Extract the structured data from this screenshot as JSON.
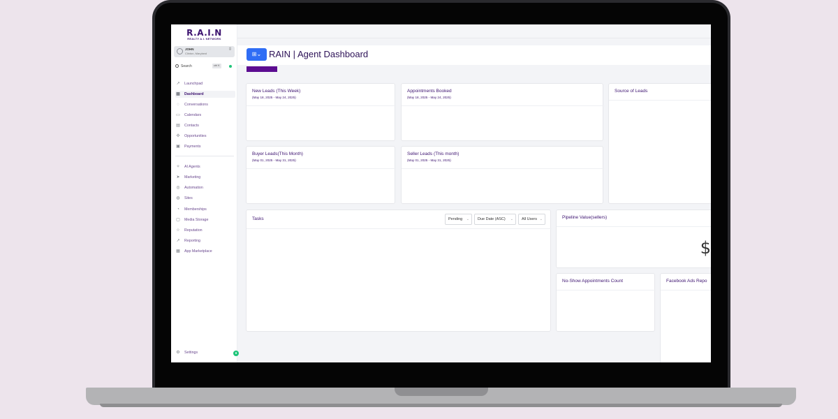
{
  "app": {
    "logo_main": "R.A.I.N",
    "logo_sub": "REALTY A.I. NETWORK",
    "page_title": "RAIN | Agent Dashboard"
  },
  "account": {
    "name": "JOHN",
    "location": "Clinton, Maryland"
  },
  "search": {
    "label": "Search",
    "shortcut": "ctrl K"
  },
  "sidebar": {
    "items": [
      {
        "label": "Launchpad",
        "icon": "rocket-icon"
      },
      {
        "label": "Dashboard",
        "icon": "grid-icon"
      },
      {
        "label": "Conversations",
        "icon": "chat-icon"
      },
      {
        "label": "Calendars",
        "icon": "calendar-icon"
      },
      {
        "label": "Contacts",
        "icon": "contacts-icon"
      },
      {
        "label": "Opportunities",
        "icon": "opportunities-icon"
      },
      {
        "label": "Payments",
        "icon": "payments-icon"
      },
      {
        "label": "AI Agents",
        "icon": "ai-icon"
      },
      {
        "label": "Marketing",
        "icon": "send-icon"
      },
      {
        "label": "Automation",
        "icon": "automation-icon"
      },
      {
        "label": "Sites",
        "icon": "globe-icon"
      },
      {
        "label": "Memberships",
        "icon": "membership-icon"
      },
      {
        "label": "Media Storage",
        "icon": "folder-icon"
      },
      {
        "label": "Reputation",
        "icon": "star-icon"
      },
      {
        "label": "Reporting",
        "icon": "chart-icon"
      },
      {
        "label": "App Marketplace",
        "icon": "apps-icon"
      }
    ],
    "settings_label": "Settings"
  },
  "cards": {
    "new_leads": {
      "title": "New Leads (This Week)",
      "range": "(May 18, 2025 - May 24, 2025)"
    },
    "appointments": {
      "title": "Appointments Booked",
      "range": "(May 18, 2025 - May 24, 2025)"
    },
    "source": {
      "title": "Source of Leads"
    },
    "buyer_leads": {
      "title": "Buyer Leads(This Month)",
      "range": "(May 01, 2025 - May 31, 2025)"
    },
    "seller_leads": {
      "title": "Seller Leads (This month)",
      "range": "(May 01, 2025 - May 31, 2025)"
    },
    "tasks": {
      "title": "Tasks",
      "filters": [
        "Pending",
        "Due Date (ASC)",
        "All Users"
      ]
    },
    "pipeline": {
      "title": "Pipeline Value(sellers)",
      "value": "$"
    },
    "no_show": {
      "title": "No-Show Appointments Count"
    },
    "facebook": {
      "title": "Facebook Ads Repo"
    }
  },
  "colors": {
    "brand": "#3d1370",
    "accent_blue": "#2f6df5",
    "accent_purple": "#5c0c91",
    "status_green": "#1fc57a"
  }
}
